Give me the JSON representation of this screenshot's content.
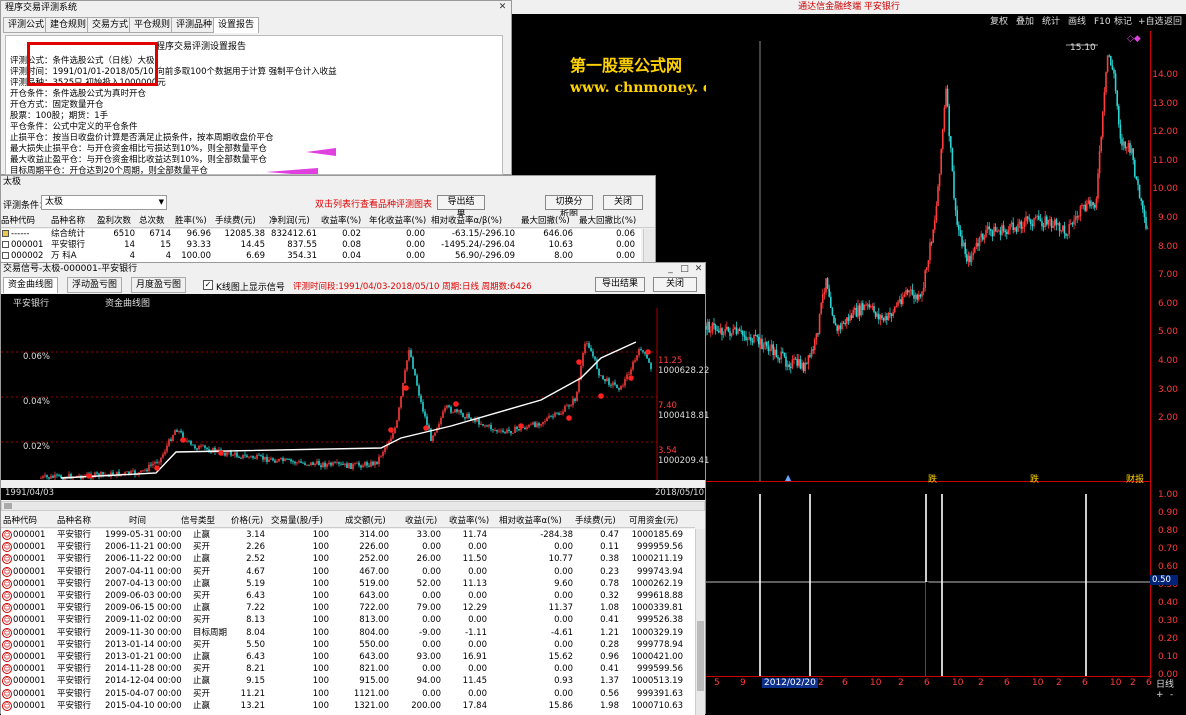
{
  "terminal": {
    "title": "通达信金融终端 平安银行",
    "toolbar": [
      "复权",
      "叠加",
      "统计",
      "画线",
      "F10",
      "标记",
      "+自选",
      "返回"
    ],
    "watermark_cn": "第一股票公式网",
    "watermark_url": "www. chnmoney. com",
    "peak_label": "15.10",
    "price_axis": [
      "14.00",
      "13.00",
      "12.00",
      "11.00",
      "10.00",
      "9.00",
      "8.00",
      "7.00",
      "6.00",
      "5.00",
      "4.00",
      "3.00",
      "2.00"
    ],
    "indicator_axis": [
      "1.00",
      "0.90",
      "0.80",
      "0.70",
      "0.60",
      "0.50",
      "0.40",
      "0.30",
      "0.20",
      "0.10",
      "0.00"
    ],
    "indicator_current": "0.50",
    "event_labels": [
      "跌",
      "跌",
      "财报"
    ],
    "date_axis": [
      "5",
      "9",
      "2012/02/20",
      "2",
      "6",
      "10",
      "2",
      "6",
      "10",
      "2",
      "6",
      "10",
      "2",
      "6",
      "10",
      "2",
      "6"
    ],
    "period": "日线",
    "zoom": [
      "+",
      "-"
    ]
  },
  "eval_window": {
    "title": "程序交易评测系统",
    "tabs": [
      "评测公式",
      "建仓规则",
      "交易方式",
      "平仓规则",
      "评测品种",
      "设置报告"
    ],
    "active_tab": 5,
    "report": {
      "heading": "程序交易评测设置报告",
      "lines": [
        "评测公式：条件选股公式（日线）大极",
        "评测时间：1991/01/01-2018/05/10  向前多取100个数据用于计算  强制平仓计入收益",
        "评测品种：3525只  初始投入1000000元",
        "开仓条件：条件选股公式为真时开仓",
        "开仓方式：固定数量开仓",
        "          股票：100股；期货：1手",
        "平仓条件：公式中定义的平仓条件",
        "止损平仓：按当日收盘价计算是否满足止损条件，按本周期收盘价平仓",
        "          最大损失止损平仓：与开仓资金相比亏损达到10%，则全部数量平仓",
        "          最大收益止盈平仓：与开仓资金相比收益达到10%，则全部数量平仓",
        "          目标周期平仓：开仓达到20个周期，则全部数量平仓"
      ]
    }
  },
  "taiji_window": {
    "title": "太极",
    "hint": "双击列表行查看品种评测图表",
    "export_label": "导出结果",
    "switch_label": "切换分析图",
    "close_label": "关闭",
    "condition_label": "评测条件：",
    "condition_value": "太极",
    "columns": [
      "品种代码",
      "品种名称",
      "盈利次数",
      "总次数",
      "胜率(%)",
      "手续费(元)",
      "净利润(元)",
      "收益率(%)",
      "年化收益率(%)",
      "相对收益率α/β(%)",
      "最大回撤(%)",
      "最大回撤比(%)"
    ],
    "rows": [
      [
        "------",
        "综合统计",
        "6510",
        "6714",
        "96.96",
        "12085.38",
        "832412.61",
        "0.02",
        "0.00",
        "-63.15/-296.10",
        "646.06",
        "0.06"
      ],
      [
        "000001",
        "平安银行",
        "14",
        "15",
        "93.33",
        "14.45",
        "837.55",
        "0.08",
        "0.00",
        "-1495.24/-296.04",
        "10.63",
        "0.00"
      ],
      [
        "000002",
        "万 科A",
        "4",
        "4",
        "100.00",
        "6.69",
        "354.31",
        "0.04",
        "0.00",
        "56.90/-296.09",
        "8.00",
        "0.00"
      ]
    ]
  },
  "signal_window": {
    "title": "交易信号-太极-000001-平安银行",
    "tabs": [
      "资金曲线图",
      "浮动盈亏图",
      "月度盈亏图"
    ],
    "checkbox_label": "K线图上显示信号",
    "period_text": "评测时间段:1991/04/03-2018/05/10  周期:日线  周期数:6426",
    "export_label": "导出结果",
    "close_label": "关闭",
    "chart_title_left": "平安银行",
    "chart_title_mid": "资金曲线图",
    "left_axis": [
      "0.06%",
      "0.04%",
      "0.02%"
    ],
    "right_axis": [
      "11.25",
      "1000628.22",
      "7.40",
      "1000418.81",
      "3.54",
      "1000209.41"
    ],
    "start_date": "1991/04/03",
    "end_date": "2018/05/10",
    "columns": [
      "品种代码",
      "品种名称",
      "时间",
      "信号类型",
      "价格(元)",
      "交易量(股/手)",
      "成交额(元)",
      "收益(元)",
      "收益率(%)",
      "相对收益率α(%)",
      "手续费(元)",
      "可用资金(元)"
    ],
    "rows": [
      [
        "000001",
        "平安银行",
        "1999-05-31 00:00",
        "止赢",
        "3.14",
        "100",
        "314.00",
        "33.00",
        "11.74",
        "-284.38",
        "0.47",
        "1000185.69"
      ],
      [
        "000001",
        "平安银行",
        "2006-11-21 00:00",
        "买开",
        "2.26",
        "100",
        "226.00",
        "0.00",
        "0.00",
        "0.00",
        "0.11",
        "999959.56"
      ],
      [
        "000001",
        "平安银行",
        "2006-11-22 00:00",
        "止赢",
        "2.52",
        "100",
        "252.00",
        "26.00",
        "11.50",
        "10.77",
        "0.38",
        "1000211.19"
      ],
      [
        "000001",
        "平安银行",
        "2007-04-11 00:00",
        "买开",
        "4.67",
        "100",
        "467.00",
        "0.00",
        "0.00",
        "0.00",
        "0.23",
        "999743.94"
      ],
      [
        "000001",
        "平安银行",
        "2007-04-13 00:00",
        "止赢",
        "5.19",
        "100",
        "519.00",
        "52.00",
        "11.13",
        "9.60",
        "0.78",
        "1000262.19"
      ],
      [
        "000001",
        "平安银行",
        "2009-06-03 00:00",
        "买开",
        "6.43",
        "100",
        "643.00",
        "0.00",
        "0.00",
        "0.00",
        "0.32",
        "999618.88"
      ],
      [
        "000001",
        "平安银行",
        "2009-06-15 00:00",
        "止赢",
        "7.22",
        "100",
        "722.00",
        "79.00",
        "12.29",
        "11.37",
        "1.08",
        "1000339.81"
      ],
      [
        "000001",
        "平安银行",
        "2009-11-02 00:00",
        "买开",
        "8.13",
        "100",
        "813.00",
        "0.00",
        "0.00",
        "0.00",
        "0.41",
        "999526.38"
      ],
      [
        "000001",
        "平安银行",
        "2009-11-30 00:00",
        "目标周期",
        "8.04",
        "100",
        "804.00",
        "-9.00",
        "-1.11",
        "-4.61",
        "1.21",
        "1000329.19"
      ],
      [
        "000001",
        "平安银行",
        "2013-01-14 00:00",
        "买开",
        "5.50",
        "100",
        "550.00",
        "0.00",
        "0.00",
        "0.00",
        "0.28",
        "999778.94"
      ],
      [
        "000001",
        "平安银行",
        "2013-01-21 00:00",
        "止赢",
        "6.43",
        "100",
        "643.00",
        "93.00",
        "16.91",
        "15.62",
        "0.96",
        "1000421.00"
      ],
      [
        "000001",
        "平安银行",
        "2014-11-28 00:00",
        "买开",
        "8.21",
        "100",
        "821.00",
        "0.00",
        "0.00",
        "0.00",
        "0.41",
        "999599.56"
      ],
      [
        "000001",
        "平安银行",
        "2014-12-04 00:00",
        "止赢",
        "9.15",
        "100",
        "915.00",
        "94.00",
        "11.45",
        "0.93",
        "1.37",
        "1000513.19"
      ],
      [
        "000001",
        "平安银行",
        "2015-04-07 00:00",
        "买开",
        "11.21",
        "100",
        "1121.00",
        "0.00",
        "0.00",
        "0.00",
        "0.56",
        "999391.63"
      ],
      [
        "000001",
        "平安银行",
        "2015-04-10 00:00",
        "止赢",
        "13.21",
        "100",
        "1321.00",
        "200.00",
        "17.84",
        "15.86",
        "1.98",
        "1000710.63"
      ]
    ]
  },
  "colors": {
    "chart_bg": "#000000",
    "axis_red": "#c00000",
    "candle_up": "#ff3b3b",
    "candle_down": "#2ad4d4",
    "equity_line": "#ffffff",
    "highlight_box": "#e00000",
    "arrow": "#e040e0",
    "watermark": "#ffd200"
  }
}
